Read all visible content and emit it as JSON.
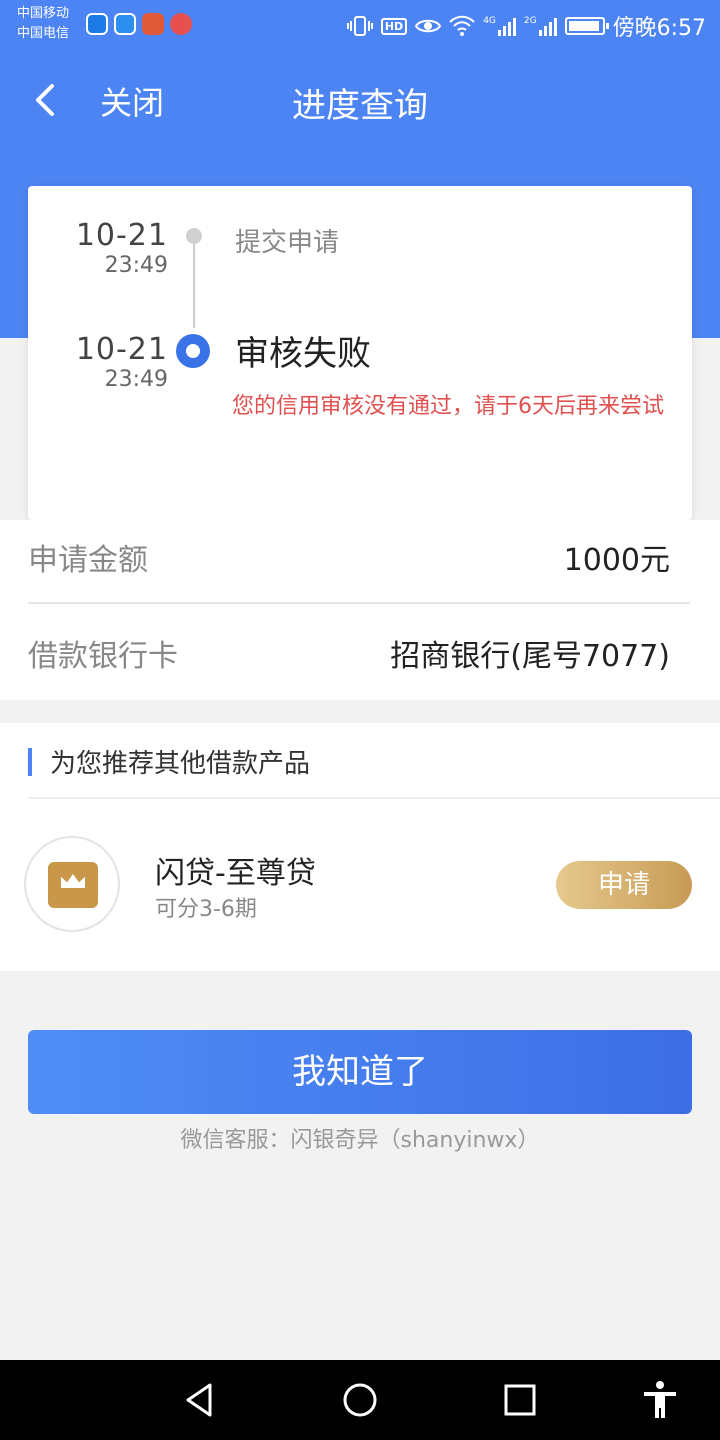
{
  "status": {
    "carrier1": "中国移动",
    "carrier2": "中国电信",
    "net1": "4G",
    "net2": "2G",
    "time": "傍晚6:57"
  },
  "header": {
    "close_label": "关闭",
    "title": "进度查询"
  },
  "progress": {
    "steps": [
      {
        "date": "10-21",
        "time": "23:49",
        "label": "提交申请"
      },
      {
        "date": "10-21",
        "time": "23:49",
        "label": "审核失败"
      }
    ],
    "fail_message": "您的信用审核没有通过，请于6天后再来尝试"
  },
  "info": {
    "amount_label": "申请金额",
    "amount_value": "1000元",
    "card_label": "借款银行卡",
    "card_value": "招商银行(尾号7077)"
  },
  "recommend": {
    "title": "为您推荐其他借款产品",
    "product_name": "闪贷-至尊贷",
    "product_sub": "可分3-6期",
    "apply_label": "申请"
  },
  "actions": {
    "ok_label": "我知道了",
    "wechat_service": "微信客服：闪银奇异（shanyinwx）"
  },
  "colors": {
    "brand_blue": "#4c84f3",
    "error_red": "#e05050",
    "gold": "#c79b55"
  },
  "icons": [
    "back-icon",
    "vibrate-icon",
    "eye-icon",
    "wifi-icon",
    "battery-icon",
    "nav-back-icon",
    "nav-home-icon",
    "nav-recent-icon",
    "accessibility-icon"
  ]
}
